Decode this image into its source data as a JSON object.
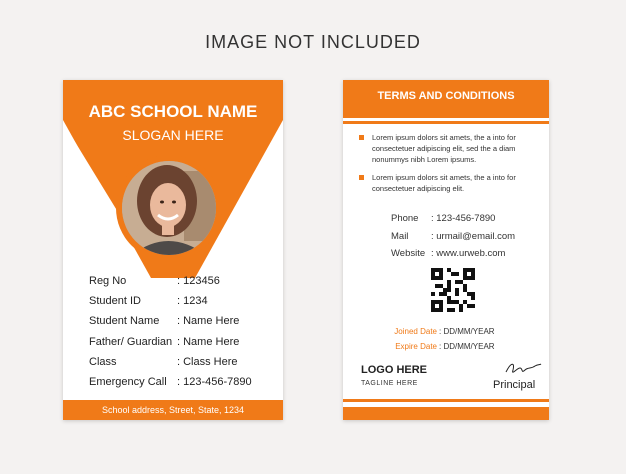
{
  "banner": "IMAGE NOT INCLUDED",
  "front": {
    "school_name": "ABC SCHOOL NAME",
    "slogan": "SLOGAN HERE",
    "fields": [
      {
        "label": "Reg No",
        "value": ": 123456"
      },
      {
        "label": "Student ID",
        "value": ": 1234"
      },
      {
        "label": "Student Name",
        "value": ": Name Here"
      },
      {
        "label": "Father/ Guardian",
        "value": ": Name Here"
      },
      {
        "label": "Class",
        "value": ": Class Here"
      },
      {
        "label": "Emergency Call",
        "value": ": 123-456-7890"
      }
    ],
    "address": "School address, Street, State, 1234"
  },
  "back": {
    "title": "TERMS AND CONDITIONS",
    "terms": [
      "Lorem ipsum dolors sit amets, the a into for consectetuer adipiscing elit, sed the a diam nonummys nibh Lorem ipsums.",
      "Lorem ipsum dolors sit amets, the a into for consectetuer adipiscing elit."
    ],
    "contacts": [
      {
        "label": "Phone",
        "value": ": 123-456-7890"
      },
      {
        "label": "Mail",
        "value": ": urmail@email.com"
      },
      {
        "label": "Website",
        "value": ": www.urweb.com"
      }
    ],
    "dates": [
      {
        "label": "Joined Date",
        "value": ": DD/MM/YEAR"
      },
      {
        "label": "Expire Date",
        "value": ": DD/MM/YEAR"
      }
    ],
    "logo": "LOGO HERE",
    "tagline": "TAGLINE HERE",
    "principal": "Principal"
  },
  "colors": {
    "accent": "#f07a18",
    "background": "#f4f2f1"
  }
}
